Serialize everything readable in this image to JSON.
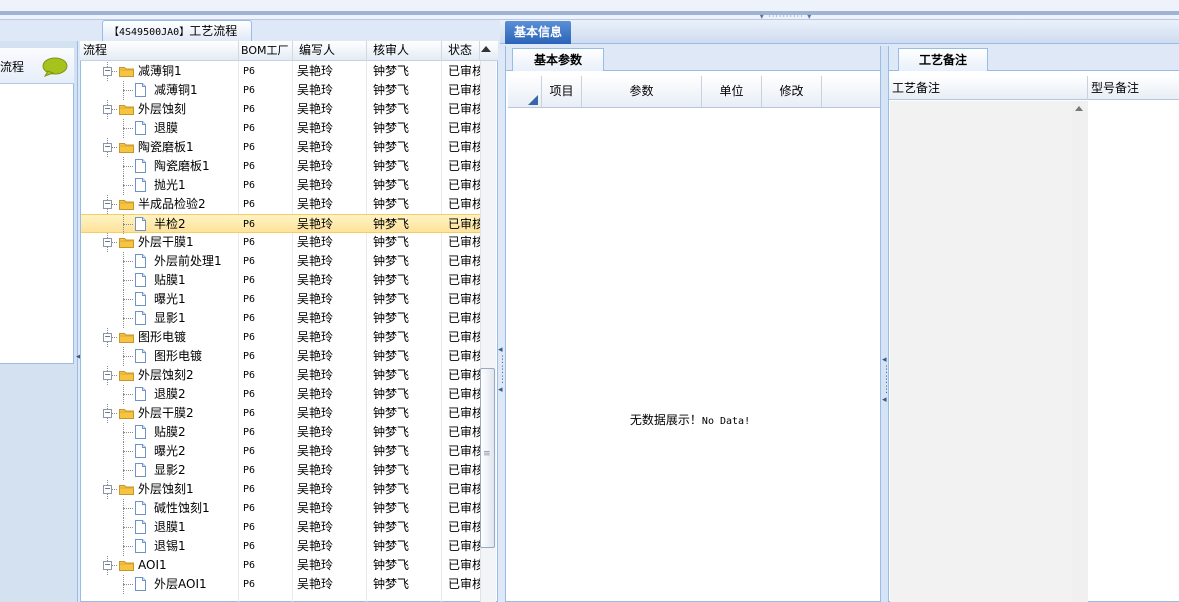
{
  "top_splitter": "▾ ·········· ▾",
  "left_panel": {
    "label": "流程"
  },
  "flow_panel": {
    "tab_label_code": "【4S49500JA0】",
    "tab_label_text": "工艺流程",
    "columns": [
      "流程",
      "BOM工厂",
      "编写人",
      "核审人",
      "状态"
    ],
    "rows": [
      {
        "name": "减薄铜1",
        "type": "folder",
        "level": 1,
        "bom": "P6",
        "writer": "吴艳玲",
        "reviewer": "钟梦飞",
        "status": "已审核"
      },
      {
        "name": "减薄铜1",
        "type": "file",
        "level": 2,
        "bom": "P6",
        "writer": "吴艳玲",
        "reviewer": "钟梦飞",
        "status": "已审核"
      },
      {
        "name": "外层蚀刻",
        "type": "folder",
        "level": 1,
        "bom": "P6",
        "writer": "吴艳玲",
        "reviewer": "钟梦飞",
        "status": "已审核"
      },
      {
        "name": "退膜",
        "type": "file",
        "level": 2,
        "bom": "P6",
        "writer": "吴艳玲",
        "reviewer": "钟梦飞",
        "status": "已审核"
      },
      {
        "name": "陶瓷磨板1",
        "type": "folder",
        "level": 1,
        "bom": "P6",
        "writer": "吴艳玲",
        "reviewer": "钟梦飞",
        "status": "已审核"
      },
      {
        "name": "陶瓷磨板1",
        "type": "file",
        "level": 2,
        "bom": "P6",
        "writer": "吴艳玲",
        "reviewer": "钟梦飞",
        "status": "已审核"
      },
      {
        "name": "抛光1",
        "type": "file",
        "level": 2,
        "bom": "P6",
        "writer": "吴艳玲",
        "reviewer": "钟梦飞",
        "status": "已审核"
      },
      {
        "name": "半成品检验2",
        "type": "folder",
        "level": 1,
        "bom": "P6",
        "writer": "吴艳玲",
        "reviewer": "钟梦飞",
        "status": "已审核"
      },
      {
        "name": "半检2",
        "type": "file",
        "level": 2,
        "bom": "P6",
        "writer": "吴艳玲",
        "reviewer": "钟梦飞",
        "status": "已审核",
        "selected": true
      },
      {
        "name": "外层干膜1",
        "type": "folder",
        "level": 1,
        "bom": "P6",
        "writer": "吴艳玲",
        "reviewer": "钟梦飞",
        "status": "已审核"
      },
      {
        "name": "外层前处理1",
        "type": "file",
        "level": 2,
        "bom": "P6",
        "writer": "吴艳玲",
        "reviewer": "钟梦飞",
        "status": "已审核"
      },
      {
        "name": "贴膜1",
        "type": "file",
        "level": 2,
        "bom": "P6",
        "writer": "吴艳玲",
        "reviewer": "钟梦飞",
        "status": "已审核"
      },
      {
        "name": "曝光1",
        "type": "file",
        "level": 2,
        "bom": "P6",
        "writer": "吴艳玲",
        "reviewer": "钟梦飞",
        "status": "已审核"
      },
      {
        "name": "显影1",
        "type": "file",
        "level": 2,
        "bom": "P6",
        "writer": "吴艳玲",
        "reviewer": "钟梦飞",
        "status": "已审核"
      },
      {
        "name": "图形电镀",
        "type": "folder",
        "level": 1,
        "bom": "P6",
        "writer": "吴艳玲",
        "reviewer": "钟梦飞",
        "status": "已审核"
      },
      {
        "name": "图形电镀",
        "type": "file",
        "level": 2,
        "bom": "P6",
        "writer": "吴艳玲",
        "reviewer": "钟梦飞",
        "status": "已审核"
      },
      {
        "name": "外层蚀刻2",
        "type": "folder",
        "level": 1,
        "bom": "P6",
        "writer": "吴艳玲",
        "reviewer": "钟梦飞",
        "status": "已审核"
      },
      {
        "name": "退膜2",
        "type": "file",
        "level": 2,
        "bom": "P6",
        "writer": "吴艳玲",
        "reviewer": "钟梦飞",
        "status": "已审核"
      },
      {
        "name": "外层干膜2",
        "type": "folder",
        "level": 1,
        "bom": "P6",
        "writer": "吴艳玲",
        "reviewer": "钟梦飞",
        "status": "已审核"
      },
      {
        "name": "贴膜2",
        "type": "file",
        "level": 2,
        "bom": "P6",
        "writer": "吴艳玲",
        "reviewer": "钟梦飞",
        "status": "已审核"
      },
      {
        "name": "曝光2",
        "type": "file",
        "level": 2,
        "bom": "P6",
        "writer": "吴艳玲",
        "reviewer": "钟梦飞",
        "status": "已审核"
      },
      {
        "name": "显影2",
        "type": "file",
        "level": 2,
        "bom": "P6",
        "writer": "吴艳玲",
        "reviewer": "钟梦飞",
        "status": "已审核"
      },
      {
        "name": "外层蚀刻1",
        "type": "folder",
        "level": 1,
        "bom": "P6",
        "writer": "吴艳玲",
        "reviewer": "钟梦飞",
        "status": "已审核"
      },
      {
        "name": "碱性蚀刻1",
        "type": "file",
        "level": 2,
        "bom": "P6",
        "writer": "吴艳玲",
        "reviewer": "钟梦飞",
        "status": "已审核"
      },
      {
        "name": "退膜1",
        "type": "file",
        "level": 2,
        "bom": "P6",
        "writer": "吴艳玲",
        "reviewer": "钟梦飞",
        "status": "已审核"
      },
      {
        "name": "退锡1",
        "type": "file",
        "level": 2,
        "bom": "P6",
        "writer": "吴艳玲",
        "reviewer": "钟梦飞",
        "status": "已审核"
      },
      {
        "name": "AOI1",
        "type": "folder",
        "level": 1,
        "bom": "P6",
        "writer": "吴艳玲",
        "reviewer": "钟梦飞",
        "status": "已审核"
      },
      {
        "name": "外层AOI1",
        "type": "file",
        "level": 2,
        "bom": "P6",
        "writer": "吴艳玲",
        "reviewer": "钟梦飞",
        "status": "已审核"
      }
    ]
  },
  "info_panel": {
    "tab_label": "基本信息",
    "params_tab": "基本参数",
    "params_columns": [
      "项目",
      "参数",
      "单位",
      "修改"
    ],
    "empty_text_cn": "无数据展示！",
    "empty_text_en": "No Data!"
  },
  "notes_panel": {
    "tab_label": "工艺备注",
    "columns": [
      "工艺备注",
      "型号备注"
    ]
  },
  "colors": {
    "accent": "#2a63b8",
    "border": "#99bbe8",
    "selected": "#fde39a"
  }
}
